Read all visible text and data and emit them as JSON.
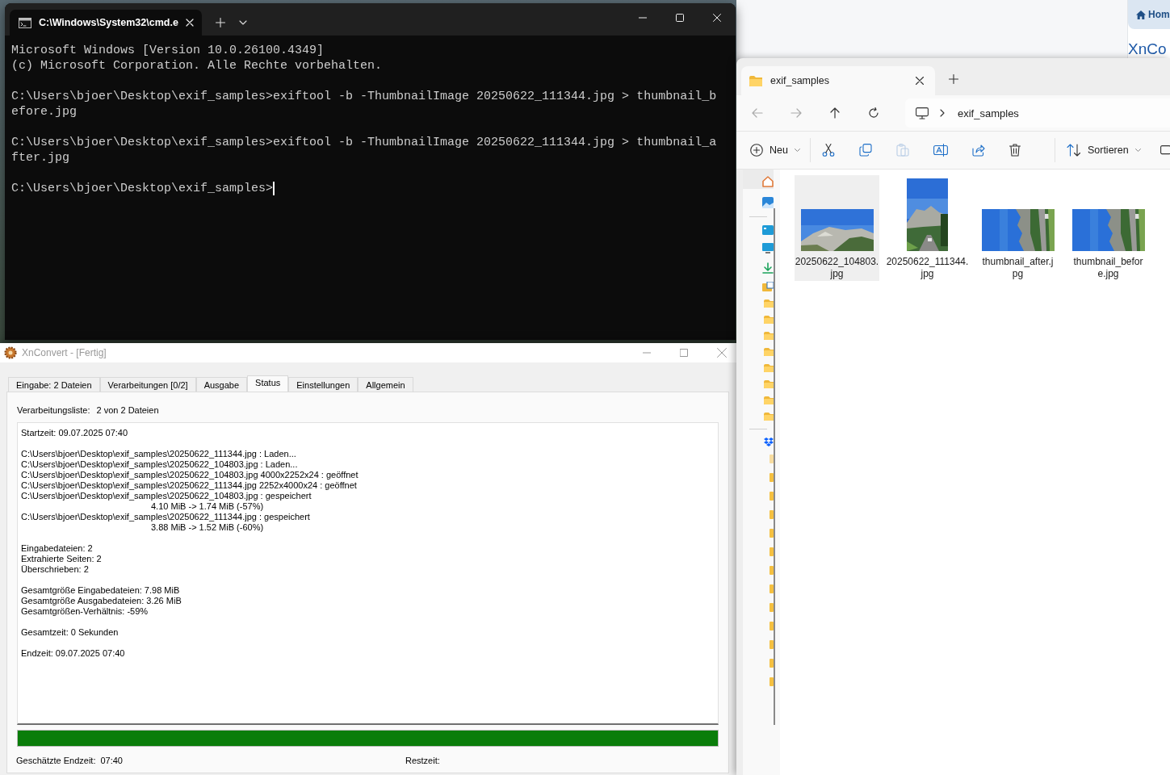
{
  "browser_window": {
    "tab_label": "Hom",
    "heading": "XnCo"
  },
  "cmd_window": {
    "tab_title": "C:\\Windows\\System32\\cmd.e",
    "console_blocks": [
      [
        "Microsoft Windows [Version 10.0.26100.4349]",
        "(c) Microsoft Corporation. Alle Rechte vorbehalten."
      ],
      [
        "C:\\Users\\bjoer\\Desktop\\exif_samples>exiftool -b -ThumbnailImage 20250622_111344.jpg > thumbnail_b",
        "efore.jpg"
      ],
      [
        "C:\\Users\\bjoer\\Desktop\\exif_samples>exiftool -b -ThumbnailImage 20250622_111344.jpg > thumbnail_a",
        "fter.jpg"
      ]
    ],
    "prompt": "C:\\Users\\bjoer\\Desktop\\exif_samples>",
    "cursor_visible": true
  },
  "xnconvert_window": {
    "title": "XnConvert - [Fertig]",
    "tabs": [
      {
        "label": "Eingabe: 2 Dateien",
        "selected": false
      },
      {
        "label": "Verarbeitungen [0/2]",
        "selected": false
      },
      {
        "label": "Ausgabe",
        "selected": false
      },
      {
        "label": "Status",
        "selected": true
      },
      {
        "label": "Einstellungen",
        "selected": false
      },
      {
        "label": "Allgemein",
        "selected": false
      }
    ],
    "list_label": "Verarbeitungsliste:",
    "list_value": "2 von 2 Dateien",
    "log_blocks": [
      [
        {
          "kind": "line",
          "text": "Startzeit: 09.07.2025 07:40"
        }
      ],
      [
        {
          "kind": "line",
          "text": "C:\\Users\\bjoer\\Desktop\\exif_samples\\20250622_111344.jpg : Laden..."
        },
        {
          "kind": "line",
          "text": "C:\\Users\\bjoer\\Desktop\\exif_samples\\20250622_104803.jpg : Laden..."
        },
        {
          "kind": "line",
          "text": "C:\\Users\\bjoer\\Desktop\\exif_samples\\20250622_104803.jpg 4000x2252x24 : geöffnet"
        },
        {
          "kind": "line",
          "text": "C:\\Users\\bjoer\\Desktop\\exif_samples\\20250622_111344.jpg 2252x4000x24 : geöffnet"
        },
        {
          "kind": "line",
          "text": "C:\\Users\\bjoer\\Desktop\\exif_samples\\20250622_104803.jpg : gespeichert"
        },
        {
          "kind": "detail",
          "text": "4.10 MiB -> 1.74 MiB (-57%)"
        },
        {
          "kind": "line",
          "text": "C:\\Users\\bjoer\\Desktop\\exif_samples\\20250622_111344.jpg : gespeichert"
        },
        {
          "kind": "detail",
          "text": "3.88 MiB -> 1.52 MiB (-60%)"
        }
      ],
      [
        {
          "kind": "line",
          "text": "Eingabedateien: 2"
        },
        {
          "kind": "line",
          "text": "Extrahierte Seiten: 2"
        },
        {
          "kind": "line",
          "text": "Überschrieben: 2"
        }
      ],
      [
        {
          "kind": "line",
          "text": "Gesamtgröße Eingabedateien: 7.98 MiB"
        },
        {
          "kind": "line",
          "text": "Gesamtgröße Ausgabedateien: 3.26 MiB"
        },
        {
          "kind": "line",
          "text": "Gesamtgrößen-Verhältnis: -59%"
        }
      ],
      [
        {
          "kind": "line",
          "text": "Gesamtzeit: 0 Sekunden"
        }
      ],
      [
        {
          "kind": "line",
          "text": "Endzeit: 09.07.2025 07:40"
        }
      ]
    ],
    "progress": {
      "level": 1
    },
    "estimated_end_label": "Geschätzte Endzeit:",
    "estimated_end_value": "07:40",
    "remaining_label": "Restzeit:"
  },
  "explorer_window": {
    "tab_title": "exif_samples",
    "breadcrumb": "exif_samples",
    "new_label": "Neu",
    "sort_label": "Sortieren",
    "files": [
      {
        "name_lines": [
          "20250622_104803.",
          "jpg"
        ],
        "selected": true,
        "kind": "picture"
      },
      {
        "name_lines": [
          "20250622_111344.",
          "jpg"
        ],
        "selected": false,
        "kind": "picture"
      },
      {
        "name_lines": [
          "thumbnail_after.j",
          "pg"
        ],
        "selected": false,
        "kind": "picture"
      },
      {
        "name_lines": [
          "thumbnail_befor",
          "e.jpg"
        ],
        "selected": false,
        "kind": "picture"
      }
    ]
  }
}
